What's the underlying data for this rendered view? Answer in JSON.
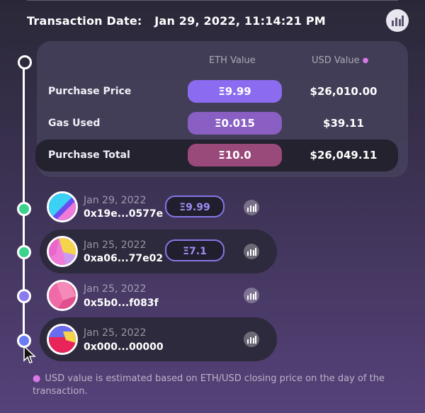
{
  "header": {
    "label": "Transaction Date:",
    "date": "Jan 29, 2022, 11:14:21 PM"
  },
  "summary": {
    "col_eth": "ETH Value",
    "col_usd": "USD Value",
    "rows": [
      {
        "label": "Purchase Price",
        "eth": "Ξ9.99",
        "usd": "$26,010.00"
      },
      {
        "label": "Gas Used",
        "eth": "Ξ0.015",
        "usd": "$39.11"
      },
      {
        "label": "Purchase Total",
        "eth": "Ξ10.0",
        "usd": "$26,049.11"
      }
    ]
  },
  "history": [
    {
      "date": "Jan 29, 2022",
      "address": "0x19e...0577e",
      "eth": "Ξ9.99"
    },
    {
      "date": "Jan 25, 2022",
      "address": "0xa06...77e02",
      "eth": "Ξ7.1"
    },
    {
      "date": "Jan 25, 2022",
      "address": "0x5b0...f083f",
      "eth": ""
    },
    {
      "date": "Jan 25, 2022",
      "address": "0x000...00000",
      "eth": ""
    }
  ],
  "footnote": "USD value is estimated based on ETH/USD closing price on the day of the transaction.",
  "colors": {
    "accent_purple": "#8577e8",
    "gas_pill": "#8a5fc4",
    "total_pill": "#9a4a7a",
    "node_green": "#3ad38e",
    "dot_pink": "#d87ae6"
  },
  "icons": [
    "brand-chart-icon",
    "etherscan-icon",
    "cursor-icon"
  ]
}
